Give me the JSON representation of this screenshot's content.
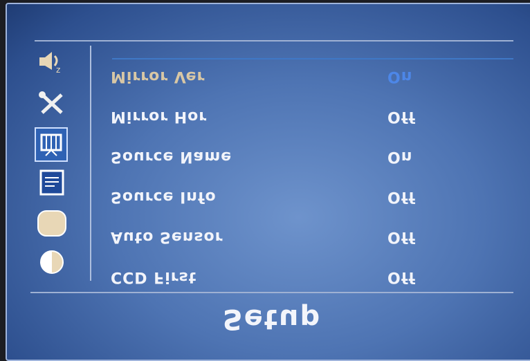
{
  "osd": {
    "title": "Setup",
    "tabs": [
      {
        "icon": "speaker-icon",
        "selected": false
      },
      {
        "icon": "tools-icon",
        "selected": false
      },
      {
        "icon": "screen-mirror-icon",
        "selected": true
      },
      {
        "icon": "source-info-icon",
        "selected": false
      },
      {
        "icon": "display-shape-icon",
        "selected": false
      },
      {
        "icon": "contrast-icon",
        "selected": false
      }
    ],
    "items": [
      {
        "label": "Mirror Ver",
        "value": "On",
        "active": true
      },
      {
        "label": "Mirror Hor",
        "value": "Off",
        "active": false
      },
      {
        "label": "Source Name",
        "value": "On",
        "active": false
      },
      {
        "label": "Source Info",
        "value": "Off",
        "active": false
      },
      {
        "label": "Auto Sensor",
        "value": "Off",
        "active": false
      },
      {
        "label": "CCD First",
        "value": "Off",
        "active": false
      }
    ]
  },
  "colors": {
    "panel": "#4e74b3",
    "selected_value": "#4d87e8",
    "selected_label": "#d8c7a5",
    "text": "#f2f4fa"
  }
}
